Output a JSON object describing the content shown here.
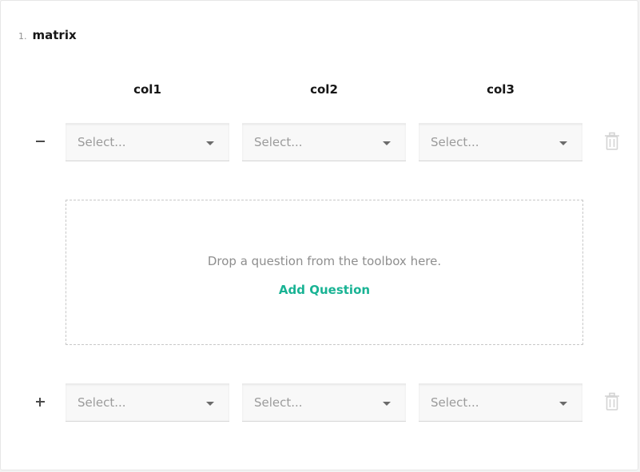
{
  "question": {
    "number": "1.",
    "title": "matrix"
  },
  "columns": [
    "col1",
    "col2",
    "col3"
  ],
  "rows": [
    {
      "toggle": "collapse",
      "cells": [
        "Select...",
        "Select...",
        "Select..."
      ]
    },
    {
      "toggle": "expand",
      "cells": [
        "Select...",
        "Select...",
        "Select..."
      ]
    }
  ],
  "detail_panel": {
    "drop_text": "Drop a question from the toolbox here.",
    "add_question_label": "Add Question"
  },
  "icons": {
    "row_1_toggle": "minus-icon",
    "row_2_toggle": "plus-icon",
    "remove_row": "trash-icon",
    "select_arrow": "caret-down-icon"
  },
  "colors": {
    "accent": "#19b394",
    "icon_muted": "#d4d4d4"
  }
}
